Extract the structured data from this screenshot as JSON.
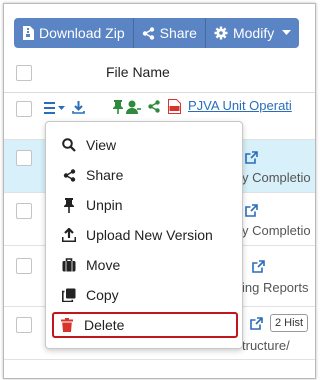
{
  "toolbar": {
    "download_label": "Download Zip",
    "share_label": "Share",
    "modify_label": "Modify"
  },
  "table": {
    "header_label": "File Name",
    "rows": [
      {
        "text": "PJVA Unit Operati"
      },
      {
        "text": "y Completio"
      },
      {
        "text": "y Completio"
      },
      {
        "text": "ing Reports"
      },
      {
        "text": "tructure/",
        "badge": "2 Hist"
      }
    ]
  },
  "menu": {
    "items": [
      {
        "label": "View",
        "icon": "search-icon"
      },
      {
        "label": "Share",
        "icon": "share-icon"
      },
      {
        "label": "Unpin",
        "icon": "pin-icon"
      },
      {
        "label": "Upload New Version",
        "icon": "upload-icon"
      },
      {
        "label": "Move",
        "icon": "briefcase-icon"
      },
      {
        "label": "Copy",
        "icon": "copy-icon"
      },
      {
        "label": "Delete",
        "icon": "trash-icon"
      }
    ]
  },
  "colors": {
    "toolbar_bg": "#5a84c4",
    "link": "#2a6ebb",
    "selected_row": "#d7f0f9",
    "delete_red": "#c0161c",
    "pin_green": "#2f8a3b",
    "pdf_red": "#d9342b"
  }
}
